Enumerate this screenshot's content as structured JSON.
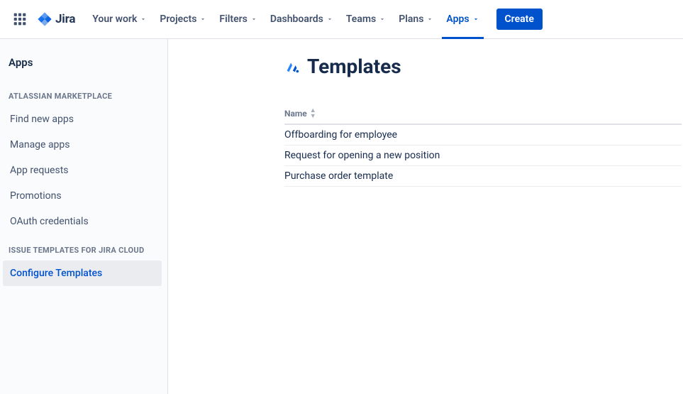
{
  "header": {
    "product": "Jira",
    "nav": [
      {
        "id": "your-work",
        "label": "Your work"
      },
      {
        "id": "projects",
        "label": "Projects"
      },
      {
        "id": "filters",
        "label": "Filters"
      },
      {
        "id": "dashboards",
        "label": "Dashboards"
      },
      {
        "id": "teams",
        "label": "Teams"
      },
      {
        "id": "plans",
        "label": "Plans"
      },
      {
        "id": "apps",
        "label": "Apps",
        "active": true
      }
    ],
    "create": "Create"
  },
  "sidebar": {
    "title": "Apps",
    "sections": [
      {
        "heading": "ATLASSIAN MARKETPLACE",
        "items": [
          {
            "id": "find-new-apps",
            "label": "Find new apps"
          },
          {
            "id": "manage-apps",
            "label": "Manage apps"
          },
          {
            "id": "app-requests",
            "label": "App requests"
          },
          {
            "id": "promotions",
            "label": "Promotions"
          },
          {
            "id": "oauth-credentials",
            "label": "OAuth credentials"
          }
        ]
      },
      {
        "heading": "ISSUE TEMPLATES FOR JIRA CLOUD",
        "items": [
          {
            "id": "configure-templates",
            "label": "Configure Templates",
            "selected": true
          }
        ]
      }
    ]
  },
  "main": {
    "title": "Templates",
    "table": {
      "column": "Name",
      "rows": [
        "Offboarding for employee",
        "Request for opening a new position",
        "Purchase order template"
      ]
    }
  },
  "colors": {
    "primary": "#0052CC",
    "text": "#172B4D",
    "subtle": "#6B778C"
  }
}
